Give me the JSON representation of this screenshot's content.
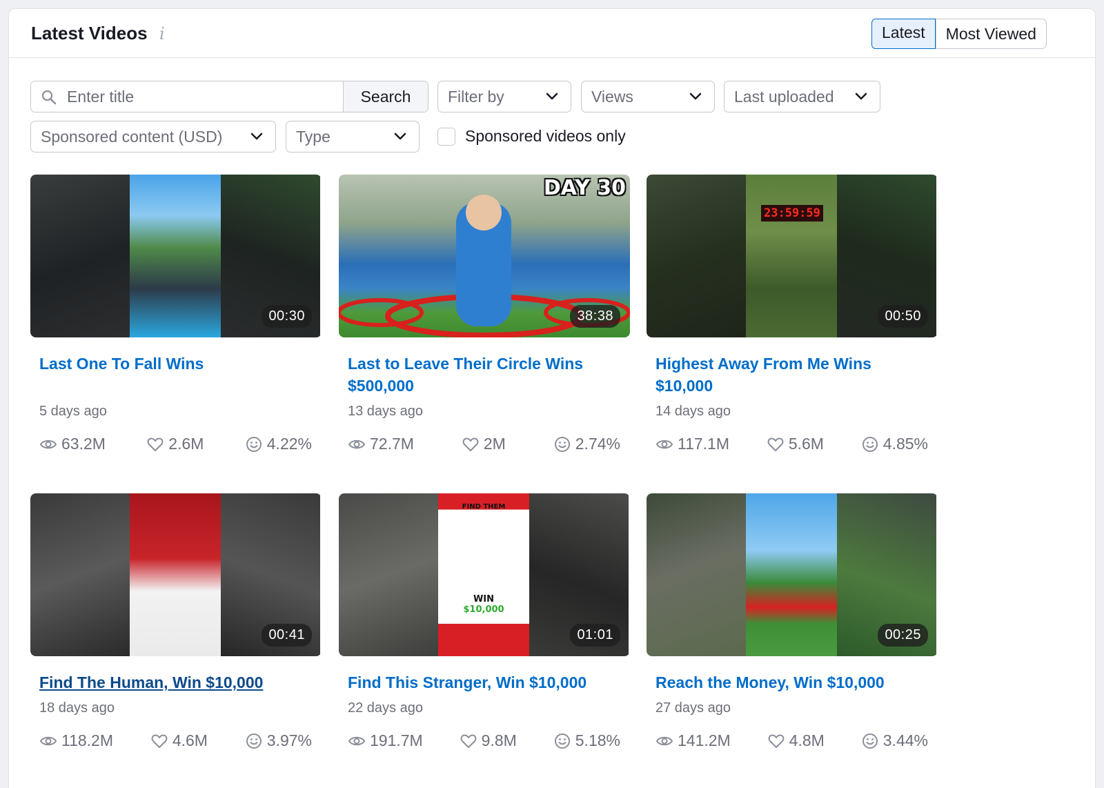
{
  "header": {
    "title": "Latest Videos",
    "info_icon": "i",
    "tabs": [
      {
        "label": "Latest",
        "active": true
      },
      {
        "label": "Most Viewed",
        "active": false
      }
    ]
  },
  "filters": {
    "search_placeholder": "Enter title",
    "search_button": "Search",
    "filter_by": "Filter by",
    "views": "Views",
    "last_uploaded": "Last uploaded",
    "sponsored_content": "Sponsored content (USD)",
    "type": "Type",
    "sponsored_only_label": "Sponsored videos only"
  },
  "videos": [
    {
      "title": "Last One To Fall Wins",
      "date": "5 days ago",
      "duration": "00:30",
      "views": "63.2M",
      "likes": "2.6M",
      "engagement": "4.22%"
    },
    {
      "title": "Last to Leave Their Circle Wins $500,000",
      "date": "13 days ago",
      "duration": "38:38",
      "views": "72.7M",
      "likes": "2M",
      "engagement": "2.74%",
      "thumb_text": "DAY 30"
    },
    {
      "title": "Highest Away From Me Wins $10,000",
      "date": "14 days ago",
      "duration": "00:50",
      "views": "117.1M",
      "likes": "5.6M",
      "engagement": "4.85%",
      "thumb_text": "23:59:59"
    },
    {
      "title": "Find The Human, Win $10,000",
      "date": "18 days ago",
      "duration": "00:41",
      "views": "118.2M",
      "likes": "4.6M",
      "engagement": "3.97%"
    },
    {
      "title": "Find This Stranger, Win $10,000",
      "date": "22 days ago",
      "duration": "01:01",
      "views": "191.7M",
      "likes": "9.8M",
      "engagement": "5.18%",
      "thumb_text": "FIND THEM",
      "thumb_text_2": "WIN",
      "thumb_text_3": "$10,000"
    },
    {
      "title": "Reach the Money, Win $10,000",
      "date": "27 days ago",
      "duration": "00:25",
      "views": "141.2M",
      "likes": "4.8M",
      "engagement": "3.44%"
    }
  ]
}
